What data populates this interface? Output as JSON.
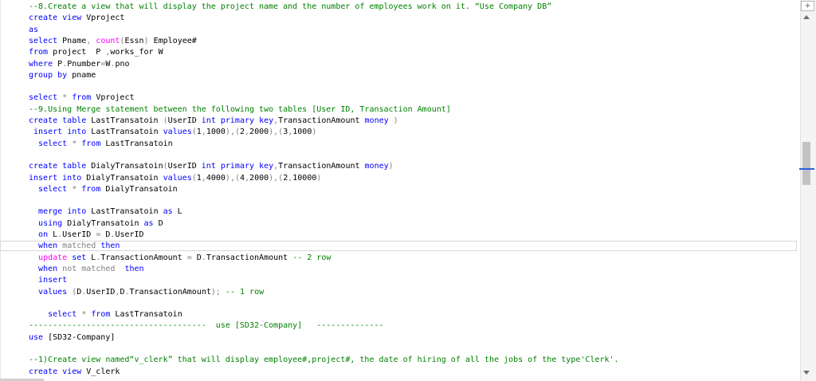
{
  "editor": {
    "lines": [
      [
        {
          "c": "c",
          "t": "--8.Create a view that will display the project name and the number of employees work on it. “Use Company DB”"
        }
      ],
      [
        {
          "c": "k",
          "t": "create"
        },
        {
          "c": "d",
          "t": " "
        },
        {
          "c": "k",
          "t": "view"
        },
        {
          "c": "d",
          "t": " Vproject"
        }
      ],
      [
        {
          "c": "k",
          "t": "as"
        }
      ],
      [
        {
          "c": "k",
          "t": "select"
        },
        {
          "c": "d",
          "t": " Pname"
        },
        {
          "c": "g",
          "t": ","
        },
        {
          "c": "d",
          "t": " "
        },
        {
          "c": "f",
          "t": "count"
        },
        {
          "c": "g",
          "t": "("
        },
        {
          "c": "d",
          "t": "Essn"
        },
        {
          "c": "g",
          "t": ")"
        },
        {
          "c": "d",
          "t": " Employee#"
        }
      ],
      [
        {
          "c": "k",
          "t": "from"
        },
        {
          "c": "d",
          "t": " project  P "
        },
        {
          "c": "g",
          "t": ","
        },
        {
          "c": "d",
          "t": "works_for W"
        }
      ],
      [
        {
          "c": "k",
          "t": "where"
        },
        {
          "c": "d",
          "t": " P"
        },
        {
          "c": "g",
          "t": "."
        },
        {
          "c": "d",
          "t": "Pnumber"
        },
        {
          "c": "g",
          "t": "="
        },
        {
          "c": "d",
          "t": "W"
        },
        {
          "c": "g",
          "t": "."
        },
        {
          "c": "d",
          "t": "pno"
        }
      ],
      [
        {
          "c": "k",
          "t": "group"
        },
        {
          "c": "d",
          "t": " "
        },
        {
          "c": "k",
          "t": "by"
        },
        {
          "c": "d",
          "t": " pname"
        }
      ],
      [],
      [
        {
          "c": "k",
          "t": "select"
        },
        {
          "c": "d",
          "t": " "
        },
        {
          "c": "g",
          "t": "*"
        },
        {
          "c": "d",
          "t": " "
        },
        {
          "c": "k",
          "t": "from"
        },
        {
          "c": "d",
          "t": " Vproject"
        }
      ],
      [
        {
          "c": "c",
          "t": "--9.Using Merge statement between the following two tables [User ID, Transaction Amount]"
        }
      ],
      [
        {
          "c": "k",
          "t": "create"
        },
        {
          "c": "d",
          "t": " "
        },
        {
          "c": "k",
          "t": "table"
        },
        {
          "c": "d",
          "t": " LastTransatoin "
        },
        {
          "c": "g",
          "t": "("
        },
        {
          "c": "d",
          "t": "UserID "
        },
        {
          "c": "k",
          "t": "int"
        },
        {
          "c": "d",
          "t": " "
        },
        {
          "c": "k",
          "t": "primary"
        },
        {
          "c": "d",
          "t": " "
        },
        {
          "c": "k",
          "t": "key"
        },
        {
          "c": "g",
          "t": ","
        },
        {
          "c": "d",
          "t": "TransactionAmount "
        },
        {
          "c": "k",
          "t": "money"
        },
        {
          "c": "d",
          "t": " "
        },
        {
          "c": "g",
          "t": ")"
        }
      ],
      [
        {
          "c": "d",
          "t": " "
        },
        {
          "c": "k",
          "t": "insert"
        },
        {
          "c": "d",
          "t": " "
        },
        {
          "c": "k",
          "t": "into"
        },
        {
          "c": "d",
          "t": " LastTransatoin "
        },
        {
          "c": "k",
          "t": "values"
        },
        {
          "c": "g",
          "t": "("
        },
        {
          "c": "d",
          "t": "1"
        },
        {
          "c": "g",
          "t": ","
        },
        {
          "c": "d",
          "t": "1000"
        },
        {
          "c": "g",
          "t": "),("
        },
        {
          "c": "d",
          "t": "2"
        },
        {
          "c": "g",
          "t": ","
        },
        {
          "c": "d",
          "t": "2000"
        },
        {
          "c": "g",
          "t": "),("
        },
        {
          "c": "d",
          "t": "3"
        },
        {
          "c": "g",
          "t": ","
        },
        {
          "c": "d",
          "t": "1000"
        },
        {
          "c": "g",
          "t": ")"
        }
      ],
      [
        {
          "c": "d",
          "t": "  "
        },
        {
          "c": "k",
          "t": "select"
        },
        {
          "c": "d",
          "t": " "
        },
        {
          "c": "g",
          "t": "*"
        },
        {
          "c": "d",
          "t": " "
        },
        {
          "c": "k",
          "t": "from"
        },
        {
          "c": "d",
          "t": " LastTransatoin"
        }
      ],
      [],
      [
        {
          "c": "k",
          "t": "create"
        },
        {
          "c": "d",
          "t": " "
        },
        {
          "c": "k",
          "t": "table"
        },
        {
          "c": "d",
          "t": " DialyTransatoin"
        },
        {
          "c": "g",
          "t": "("
        },
        {
          "c": "d",
          "t": "UserID "
        },
        {
          "c": "k",
          "t": "int"
        },
        {
          "c": "d",
          "t": " "
        },
        {
          "c": "k",
          "t": "primary"
        },
        {
          "c": "d",
          "t": " "
        },
        {
          "c": "k",
          "t": "key"
        },
        {
          "c": "g",
          "t": ","
        },
        {
          "c": "d",
          "t": "TransactionAmount "
        },
        {
          "c": "k",
          "t": "money"
        },
        {
          "c": "g",
          "t": ")"
        }
      ],
      [
        {
          "c": "k",
          "t": "insert"
        },
        {
          "c": "d",
          "t": " "
        },
        {
          "c": "k",
          "t": "into"
        },
        {
          "c": "d",
          "t": " DialyTransatoin "
        },
        {
          "c": "k",
          "t": "values"
        },
        {
          "c": "g",
          "t": "("
        },
        {
          "c": "d",
          "t": "1"
        },
        {
          "c": "g",
          "t": ","
        },
        {
          "c": "d",
          "t": "4000"
        },
        {
          "c": "g",
          "t": "),("
        },
        {
          "c": "d",
          "t": "4"
        },
        {
          "c": "g",
          "t": ","
        },
        {
          "c": "d",
          "t": "2000"
        },
        {
          "c": "g",
          "t": "),("
        },
        {
          "c": "d",
          "t": "2"
        },
        {
          "c": "g",
          "t": ","
        },
        {
          "c": "d",
          "t": "10000"
        },
        {
          "c": "g",
          "t": ")"
        }
      ],
      [
        {
          "c": "d",
          "t": "  "
        },
        {
          "c": "k",
          "t": "select"
        },
        {
          "c": "d",
          "t": " "
        },
        {
          "c": "g",
          "t": "*"
        },
        {
          "c": "d",
          "t": " "
        },
        {
          "c": "k",
          "t": "from"
        },
        {
          "c": "d",
          "t": " DialyTransatoin"
        }
      ],
      [],
      [
        {
          "c": "d",
          "t": "  "
        },
        {
          "c": "k",
          "t": "merge"
        },
        {
          "c": "d",
          "t": " "
        },
        {
          "c": "k",
          "t": "into"
        },
        {
          "c": "d",
          "t": " LastTransatoin "
        },
        {
          "c": "k",
          "t": "as"
        },
        {
          "c": "d",
          "t": " L"
        }
      ],
      [
        {
          "c": "d",
          "t": "  "
        },
        {
          "c": "k",
          "t": "using"
        },
        {
          "c": "d",
          "t": " DialyTransatoin "
        },
        {
          "c": "k",
          "t": "as"
        },
        {
          "c": "d",
          "t": " D"
        }
      ],
      [
        {
          "c": "d",
          "t": "  "
        },
        {
          "c": "k",
          "t": "on"
        },
        {
          "c": "d",
          "t": " L"
        },
        {
          "c": "g",
          "t": "."
        },
        {
          "c": "d",
          "t": "UserID "
        },
        {
          "c": "g",
          "t": "="
        },
        {
          "c": "d",
          "t": " D"
        },
        {
          "c": "g",
          "t": "."
        },
        {
          "c": "d",
          "t": "UserID"
        }
      ],
      [
        {
          "c": "d",
          "t": "  "
        },
        {
          "c": "k",
          "t": "when"
        },
        {
          "c": "d",
          "t": " "
        },
        {
          "c": "g",
          "t": "matched"
        },
        {
          "c": "d",
          "t": " "
        },
        {
          "c": "k",
          "t": "then"
        }
      ],
      [
        {
          "c": "d",
          "t": "  "
        },
        {
          "c": "f",
          "t": "update"
        },
        {
          "c": "d",
          "t": " "
        },
        {
          "c": "k",
          "t": "set"
        },
        {
          "c": "d",
          "t": " L"
        },
        {
          "c": "g",
          "t": "."
        },
        {
          "c": "d",
          "t": "TransactionAmount "
        },
        {
          "c": "g",
          "t": "="
        },
        {
          "c": "d",
          "t": " D"
        },
        {
          "c": "g",
          "t": "."
        },
        {
          "c": "d",
          "t": "TransactionAmount "
        },
        {
          "c": "c",
          "t": "-- 2 row"
        }
      ],
      [
        {
          "c": "d",
          "t": "  "
        },
        {
          "c": "k",
          "t": "when"
        },
        {
          "c": "d",
          "t": " "
        },
        {
          "c": "g",
          "t": "not"
        },
        {
          "c": "d",
          "t": " "
        },
        {
          "c": "g",
          "t": "matched"
        },
        {
          "c": "d",
          "t": "  "
        },
        {
          "c": "k",
          "t": "then"
        }
      ],
      [
        {
          "c": "d",
          "t": "  "
        },
        {
          "c": "k",
          "t": "insert"
        }
      ],
      [
        {
          "c": "d",
          "t": "  "
        },
        {
          "c": "k",
          "t": "values"
        },
        {
          "c": "d",
          "t": " "
        },
        {
          "c": "g",
          "t": "("
        },
        {
          "c": "d",
          "t": "D"
        },
        {
          "c": "g",
          "t": "."
        },
        {
          "c": "d",
          "t": "UserID"
        },
        {
          "c": "g",
          "t": ","
        },
        {
          "c": "d",
          "t": "D"
        },
        {
          "c": "g",
          "t": "."
        },
        {
          "c": "d",
          "t": "TransactionAmount"
        },
        {
          "c": "g",
          "t": ");"
        },
        {
          "c": "d",
          "t": " "
        },
        {
          "c": "c",
          "t": "-- 1 row"
        }
      ],
      [],
      [
        {
          "c": "d",
          "t": "    "
        },
        {
          "c": "k",
          "t": "select"
        },
        {
          "c": "d",
          "t": " "
        },
        {
          "c": "g",
          "t": "*"
        },
        {
          "c": "d",
          "t": " "
        },
        {
          "c": "k",
          "t": "from"
        },
        {
          "c": "d",
          "t": " LastTransatoin"
        }
      ],
      [
        {
          "c": "c",
          "t": "-------------------------------------  use [SD32-Company]   --------------"
        }
      ],
      [
        {
          "c": "k",
          "t": "use"
        },
        {
          "c": "d",
          "t": " [SD32-Company]"
        }
      ],
      [],
      [
        {
          "c": "c",
          "t": "--1)Create view named“v_clerk” that will display employee#,project#, the date of hiring of all the jobs of the type'Clerk'."
        }
      ],
      [
        {
          "c": "k",
          "t": "create"
        },
        {
          "c": "d",
          "t": " "
        },
        {
          "c": "k",
          "t": "view"
        },
        {
          "c": "d",
          "t": " V_clerk"
        }
      ]
    ]
  },
  "scrollbar": {
    "split_glyph": "÷"
  }
}
